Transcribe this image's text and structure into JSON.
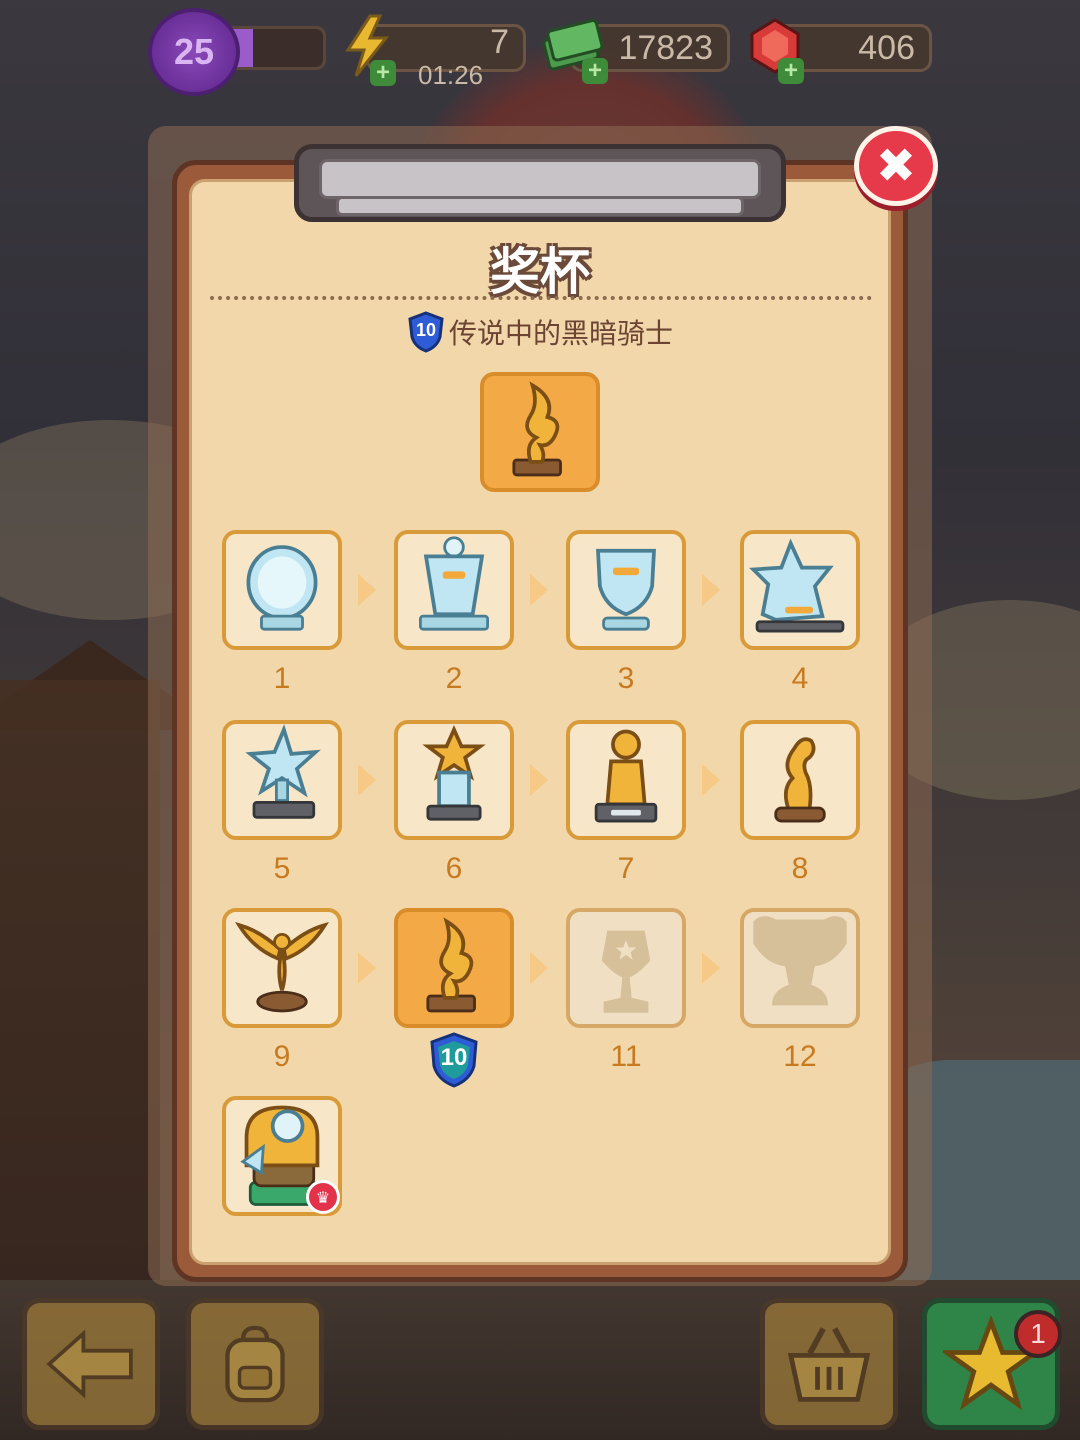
{
  "hud": {
    "level": "25",
    "xp_progress": 0.3,
    "energy": "7",
    "energy_timer": "01:26",
    "cash": "17823",
    "gems": "406",
    "plus_label": "+"
  },
  "panel": {
    "title": "奖杯",
    "rank_level": "10",
    "rank_name": "传说中的黑暗骑士",
    "close_label": "✖"
  },
  "trophies": [
    {
      "label": "1",
      "state": "unlocked",
      "icon": "crystal-round-trophy-icon"
    },
    {
      "label": "2",
      "state": "unlocked",
      "icon": "crystal-plaque-trophy-icon"
    },
    {
      "label": "3",
      "state": "unlocked",
      "icon": "crystal-shield-trophy-icon"
    },
    {
      "label": "4",
      "state": "unlocked",
      "icon": "crystal-star-trophy-icon"
    },
    {
      "label": "5",
      "state": "unlocked",
      "icon": "crystal-star-statue-icon"
    },
    {
      "label": "6",
      "state": "unlocked",
      "icon": "gold-star-crystal-trophy-icon"
    },
    {
      "label": "7",
      "state": "unlocked",
      "icon": "gold-pawn-trophy-icon"
    },
    {
      "label": "8",
      "state": "unlocked",
      "icon": "gold-knight-trophy-icon"
    },
    {
      "label": "9",
      "state": "unlocked",
      "icon": "gold-winged-trophy-icon"
    },
    {
      "label": "10",
      "state": "current",
      "icon": "gold-dragon-trophy-icon"
    },
    {
      "label": "11",
      "state": "locked",
      "icon": "locked-star-trophy-icon"
    },
    {
      "label": "12",
      "state": "locked",
      "icon": "locked-cup-trophy-icon"
    },
    {
      "label": "",
      "state": "special",
      "icon": "orb-cannon-trophy-icon"
    }
  ],
  "current_badge": "10",
  "crown_symbol": "♛",
  "bottom_bar": {
    "notification_count": "1"
  },
  "colors": {
    "panel_bg": "#f1d7a9",
    "tile_border": "#d99a3a",
    "current_tile": "#f3a945",
    "label_color": "#c77a1f",
    "close_red": "#e63a4a",
    "shield_blue": "#2e5bd6",
    "shield_teal": "#1f9b9b"
  }
}
